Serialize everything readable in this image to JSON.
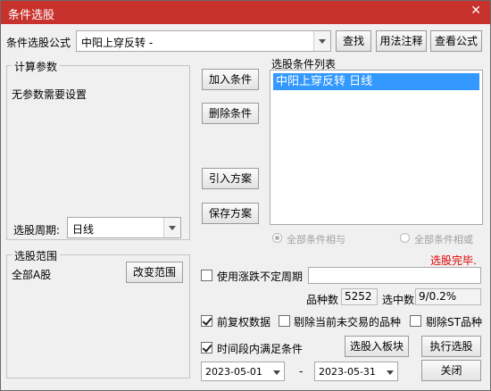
{
  "window": {
    "title": "条件选股",
    "close_glyph": "✕"
  },
  "formula": {
    "label": "条件选股公式",
    "value": "中阳上穿反转  -",
    "find_button": "查找",
    "usage_button": "用法注释",
    "view_button": "查看公式"
  },
  "params": {
    "group_title": "计算参数",
    "no_params_text": "无参数需要设置",
    "period_label": "选股周期:",
    "period_value": "日线"
  },
  "actions": {
    "add": "加入条件",
    "delete": "删除条件",
    "import": "引入方案",
    "save": "保存方案"
  },
  "conditions": {
    "list_title": "选股条件列表",
    "items": [
      "中阳上穿反转  日线"
    ],
    "radio_and": "全部条件相与",
    "radio_or": "全部条件相或",
    "status": "选股完毕.",
    "status_color": "#e00000"
  },
  "range": {
    "group_title": "选股范围",
    "value": "全部A股",
    "change_button": "改变范围"
  },
  "options": {
    "irregular_period_label": "使用涨跌不定周期",
    "count_label": "品种数",
    "count_value": "5252",
    "selected_label": "选中数",
    "selected_value": "9/0.2%",
    "prior_adjust_label": "前复权数据",
    "exclude_untraded_label": "剔除当前未交易的品种",
    "exclude_st_label": "剔除ST品种",
    "period_satisfy_label": "时间段内满足条件",
    "to_block_button": "选股入板块",
    "execute_button": "执行选股",
    "date_from": "2023-05-01",
    "date_sep": "-",
    "date_to": "2023-05-31",
    "close_button": "关闭"
  },
  "colors": {
    "titlebar": "#c8322d",
    "selection": "#3399ff"
  }
}
